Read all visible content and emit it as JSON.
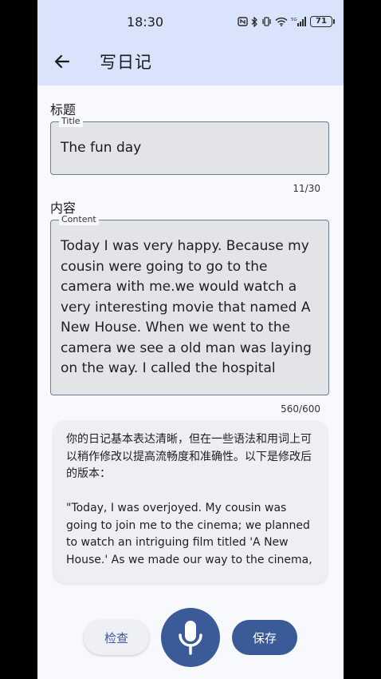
{
  "status_bar": {
    "time": "18:30",
    "battery": "71",
    "network": "5G"
  },
  "header": {
    "title": "写日记",
    "back_icon": "arrow-left-icon"
  },
  "title_section": {
    "label": "标题",
    "legend": "Title",
    "value": "The fun day",
    "counter": "11/30"
  },
  "content_section": {
    "label": "内容",
    "legend": "Content",
    "value": "Today I was very happy. Because my cousin were going to go to the camera with me.we would watch a very interesting movie that named A New House. When we went to the  camera we see a old man was laying on the way. I called the hospital quickly and",
    "counter": "560/600"
  },
  "feedback": {
    "text": "你的日记基本表达清晰，但在一些语法和用词上可以稍作修改以提高流畅度和准确性。以下是修改后的版本：\n\n\"Today, I was overjoyed. My cousin was going to join me to the cinema; we planned to watch an intriguing film titled 'A New House.' As we made our way to the cinema,"
  },
  "actions": {
    "check_label": "检查",
    "save_label": "保存",
    "mic_icon": "microphone-icon"
  },
  "colors": {
    "header_bg": "#d9e3fb",
    "primary": "#3a5a98",
    "field_bg": "#e3e4e8",
    "page_bg": "#f7f9fd"
  }
}
